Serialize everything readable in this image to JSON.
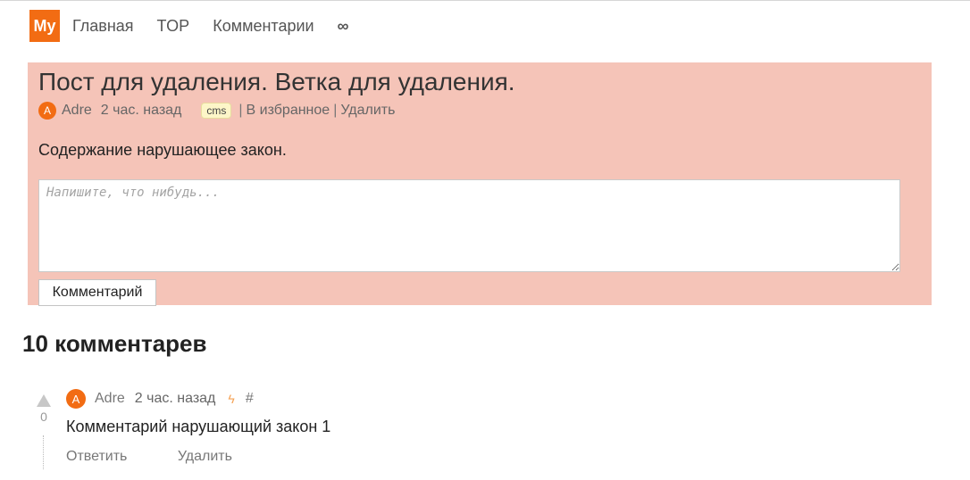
{
  "nav": {
    "logo": "My",
    "links": [
      "Главная",
      "TOP",
      "Комментарии",
      "∞"
    ]
  },
  "post": {
    "title": "Пост для удаления. Ветка для удаления.",
    "avatar_letter": "A",
    "author": "Adre",
    "time": "2 час. назад",
    "tag": "cms",
    "sep": "|",
    "favorite": "В избранное",
    "delete": "Удалить",
    "body": "Содержание нарушающее закон."
  },
  "form": {
    "placeholder": "Напишите, что нибудь...",
    "submit": "Комментарий"
  },
  "comments": {
    "heading": "10 комментарев",
    "items": [
      {
        "avatar_letter": "A",
        "author": "Adre",
        "time": "2 час. назад",
        "bolt": "ϟ",
        "hash": "#",
        "votes": "0",
        "text": "Комментарий нарушающий закон 1",
        "reply": "Ответить",
        "delete": "Удалить"
      }
    ]
  },
  "colors": {
    "accent": "#f26c13",
    "post_bg": "#f5c4b8",
    "tag_bg": "#fdf6c8"
  }
}
